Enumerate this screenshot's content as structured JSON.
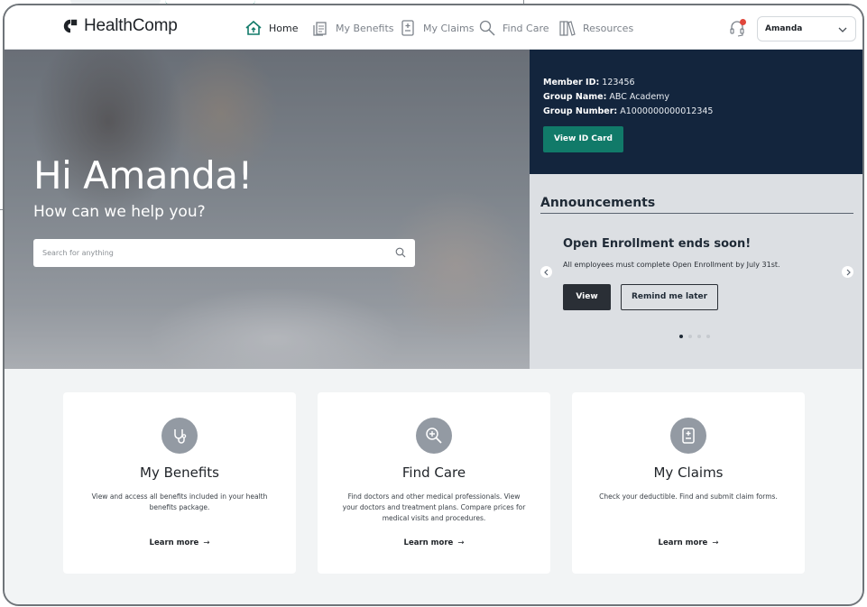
{
  "brand": {
    "name": "HealthComp"
  },
  "nav": {
    "items": [
      {
        "label": "Home",
        "icon": "home-icon",
        "active": true
      },
      {
        "label": "My Benefits",
        "icon": "benefits-icon",
        "active": false
      },
      {
        "label": "My Claims",
        "icon": "claims-icon",
        "active": false
      },
      {
        "label": "Find Care",
        "icon": "search-icon",
        "active": false
      },
      {
        "label": "Resources",
        "icon": "books-icon",
        "active": false
      }
    ],
    "user": "Amanda"
  },
  "hero": {
    "greeting": "Hi Amanda!",
    "subtitle": "How can we help you?",
    "search_placeholder": "Search for anything"
  },
  "member": {
    "id_label": "Member ID:",
    "id_value": "123456",
    "group_name_label": "Group Name:",
    "group_name_value": "ABC Academy",
    "group_number_label": "Group Number:",
    "group_number_value": "A1000000000012345",
    "button": "View ID Card"
  },
  "announcements": {
    "title": "Announcements",
    "headline": "Open Enrollment ends soon!",
    "body": "All employees must complete Open Enrollment by July 31st.",
    "view_label": "View",
    "remind_label": "Remind me later",
    "slide_count": 4,
    "active_slide": 1
  },
  "cards": [
    {
      "title": "My Benefits",
      "description": "View and access all benefits included in your health benefits package.",
      "link": "Learn more",
      "icon": "stethoscope-icon"
    },
    {
      "title": "Find Care",
      "description": "Find doctors and other medical professionals. View your doctors and treatment plans. Compare prices for medical visits and procedures.",
      "link": "Learn more",
      "icon": "magnify-plus-icon"
    },
    {
      "title": "My Claims",
      "description": "Check your deductible. Find and submit claim forms.",
      "link": "Learn more",
      "icon": "clipboard-plus-icon"
    }
  ],
  "colors": {
    "brand_teal": "#117a69",
    "navy": "#13253d",
    "notification": "#e0463b"
  }
}
